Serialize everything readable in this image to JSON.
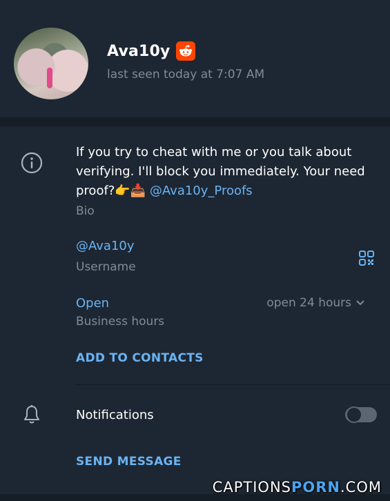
{
  "profile": {
    "name": "Ava10y",
    "badge_icon": "reddit-icon",
    "last_seen": "last seen today at 7:07 AM",
    "avatar_icon": "profile-photo"
  },
  "bio": {
    "text": "If you try to cheat with me or you talk about verifying. I'll block you immediately. Your need proof?👉📥 ",
    "link": "@Ava10y_Proofs",
    "label": "Bio"
  },
  "username": {
    "value": "@Ava10y",
    "label": "Username",
    "qr_icon": "qr-code-icon"
  },
  "business_hours": {
    "status": "Open",
    "label": "Business hours",
    "value": "open 24 hours"
  },
  "actions": {
    "add_to_contacts": "ADD TO CONTACTS",
    "send_message": "SEND MESSAGE"
  },
  "notifications": {
    "label": "Notifications",
    "enabled": false
  },
  "watermark": {
    "part1": "CAPTIONS",
    "part2": "PORN",
    "part3": ".COM"
  },
  "colors": {
    "background": "#1d2733",
    "accent": "#6ab3f3",
    "muted": "#7f8c99",
    "reddit": "#ff4500"
  }
}
